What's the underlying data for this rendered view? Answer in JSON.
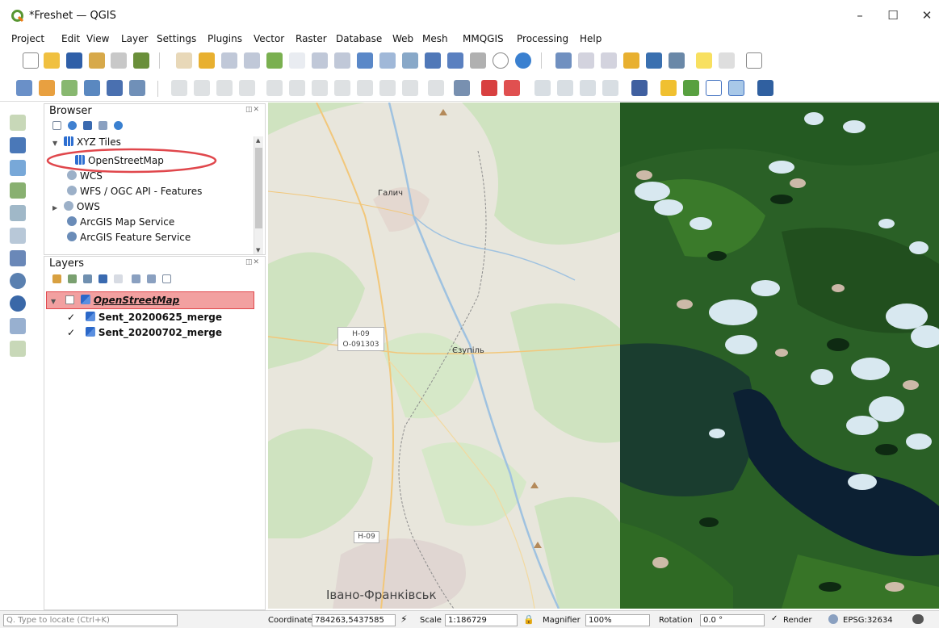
{
  "window": {
    "title": "*Freshet — QGIS",
    "minimize_symbol": "–",
    "maximize_symbol": "☐",
    "close_symbol": "✕"
  },
  "menu": [
    "Project",
    "Edit",
    "View",
    "Layer",
    "Settings",
    "Plugins",
    "Vector",
    "Raster",
    "Database",
    "Web",
    "Mesh",
    "MMQGIS",
    "Processing",
    "Help"
  ],
  "browser": {
    "title": "Browser",
    "items": [
      {
        "label": "XYZ Tiles",
        "icon": "xyz-tiles-icon"
      },
      {
        "label": "OpenStreetMap",
        "icon": "xyz-tiles-icon"
      },
      {
        "label": "WCS",
        "icon": "wcs-icon"
      },
      {
        "label": "WFS / OGC API - Features",
        "icon": "wfs-icon"
      },
      {
        "label": "OWS",
        "icon": "ows-icon"
      },
      {
        "label": "ArcGIS Map Service",
        "icon": "arcgis-icon"
      },
      {
        "label": "ArcGIS Feature Service",
        "icon": "arcgis-icon"
      }
    ]
  },
  "layers": {
    "title": "Layers",
    "items": [
      {
        "label": "OpenStreetMap",
        "checked": false,
        "highlighted": true
      },
      {
        "label": "Sent_20200625_merge",
        "checked": true,
        "highlighted": false
      },
      {
        "label": "Sent_20200702_merge",
        "checked": true,
        "highlighted": false
      }
    ]
  },
  "map": {
    "labels": {
      "galych": "Галич",
      "road1": "H-09",
      "road1b": "O-091303",
      "yezupil": "Єзупіль",
      "road2": "H-09",
      "ivano": "Івано-Франківськ"
    }
  },
  "status": {
    "locate_placeholder": "Q. Type to locate (Ctrl+K)",
    "coordinate_label": "Coordinate",
    "coordinate_value": "784263,5437585",
    "scale_label": "Scale",
    "scale_value": "1:186729",
    "magnifier_label": "Magnifier",
    "magnifier_value": "100%",
    "rotation_label": "Rotation",
    "rotation_value": "0.0 °",
    "render_label": "Render",
    "crs": "EPSG:32634"
  },
  "colors": {
    "highlight_red": "#e0474c",
    "layer_highlight_bg": "#f2a0a0",
    "qgis_green": "#589632"
  }
}
